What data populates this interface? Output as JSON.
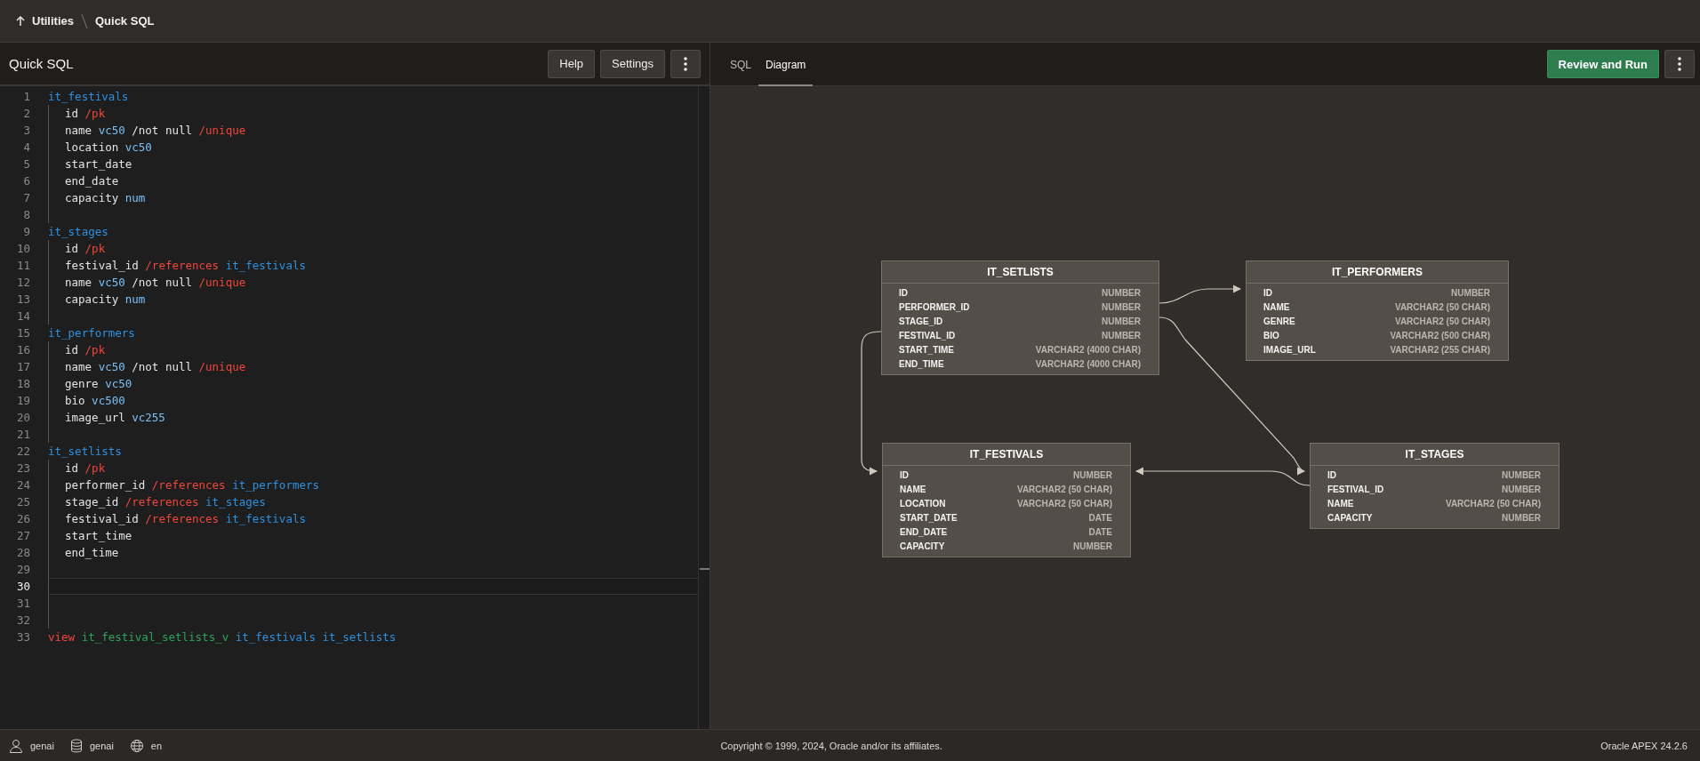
{
  "breadcrumb": [
    {
      "label": "Utilities"
    },
    {
      "label": "Quick SQL"
    }
  ],
  "editor": {
    "title": "Quick SQL",
    "buttons": [
      "Help",
      "Settings"
    ],
    "lines": [
      {
        "number": "1",
        "indented": false,
        "current": false,
        "tokens": [
          {
            "text": "it_festivals",
            "kind": "table"
          }
        ]
      },
      {
        "number": "2",
        "indented": true,
        "current": false,
        "tokens": [
          {
            "text": "id",
            "kind": "plain"
          },
          {
            "text": "/pk",
            "kind": "directive"
          }
        ]
      },
      {
        "number": "3",
        "indented": true,
        "current": false,
        "tokens": [
          {
            "text": "name",
            "kind": "plain"
          },
          {
            "text": "vc50",
            "kind": "datatype"
          },
          {
            "text": "/not null",
            "kind": "plain"
          },
          {
            "text": "/unique",
            "kind": "directive"
          }
        ]
      },
      {
        "number": "4",
        "indented": true,
        "current": false,
        "tokens": [
          {
            "text": "location",
            "kind": "plain"
          },
          {
            "text": "vc50",
            "kind": "datatype"
          }
        ]
      },
      {
        "number": "5",
        "indented": true,
        "current": false,
        "tokens": [
          {
            "text": "start_date",
            "kind": "plain"
          }
        ]
      },
      {
        "number": "6",
        "indented": true,
        "current": false,
        "tokens": [
          {
            "text": "end_date",
            "kind": "plain"
          }
        ]
      },
      {
        "number": "7",
        "indented": true,
        "current": false,
        "tokens": [
          {
            "text": "capacity",
            "kind": "plain"
          },
          {
            "text": "num",
            "kind": "datatype"
          }
        ]
      },
      {
        "number": "8",
        "indented": true,
        "current": false
      },
      {
        "number": "9",
        "indented": false,
        "current": false,
        "tokens": [
          {
            "text": "it_stages",
            "kind": "table"
          }
        ]
      },
      {
        "number": "10",
        "indented": true,
        "current": false,
        "tokens": [
          {
            "text": "id",
            "kind": "plain"
          },
          {
            "text": "/pk",
            "kind": "directive"
          }
        ]
      },
      {
        "number": "11",
        "indented": true,
        "current": false,
        "tokens": [
          {
            "text": "festival_id",
            "kind": "plain"
          },
          {
            "text": "/references",
            "kind": "directive"
          },
          {
            "text": "it_festivals",
            "kind": "table"
          }
        ]
      },
      {
        "number": "12",
        "indented": true,
        "current": false,
        "tokens": [
          {
            "text": "name",
            "kind": "plain"
          },
          {
            "text": "vc50",
            "kind": "datatype"
          },
          {
            "text": "/not null",
            "kind": "plain"
          },
          {
            "text": "/unique",
            "kind": "directive"
          }
        ]
      },
      {
        "number": "13",
        "indented": true,
        "current": false,
        "tokens": [
          {
            "text": "capacity",
            "kind": "plain"
          },
          {
            "text": "num",
            "kind": "datatype"
          }
        ]
      },
      {
        "number": "14",
        "indented": true,
        "current": false
      },
      {
        "number": "15",
        "indented": false,
        "current": false,
        "tokens": [
          {
            "text": "it_performers",
            "kind": "table"
          }
        ]
      },
      {
        "number": "16",
        "indented": true,
        "current": false,
        "tokens": [
          {
            "text": "id",
            "kind": "plain"
          },
          {
            "text": "/pk",
            "kind": "directive"
          }
        ]
      },
      {
        "number": "17",
        "indented": true,
        "current": false,
        "tokens": [
          {
            "text": "name",
            "kind": "plain"
          },
          {
            "text": "vc50",
            "kind": "datatype"
          },
          {
            "text": "/not null",
            "kind": "plain"
          },
          {
            "text": "/unique",
            "kind": "directive"
          }
        ]
      },
      {
        "number": "18",
        "indented": true,
        "current": false,
        "tokens": [
          {
            "text": "genre",
            "kind": "plain"
          },
          {
            "text": "vc50",
            "kind": "datatype"
          }
        ]
      },
      {
        "number": "19",
        "indented": true,
        "current": false,
        "tokens": [
          {
            "text": "bio",
            "kind": "plain"
          },
          {
            "text": "vc500",
            "kind": "datatype"
          }
        ]
      },
      {
        "number": "20",
        "indented": true,
        "current": false,
        "tokens": [
          {
            "text": "image_url",
            "kind": "plain"
          },
          {
            "text": "vc255",
            "kind": "datatype"
          }
        ]
      },
      {
        "number": "21",
        "indented": true,
        "current": false
      },
      {
        "number": "22",
        "indented": false,
        "current": false,
        "tokens": [
          {
            "text": "it_setlists",
            "kind": "table"
          }
        ]
      },
      {
        "number": "23",
        "indented": true,
        "current": false,
        "tokens": [
          {
            "text": "id",
            "kind": "plain"
          },
          {
            "text": "/pk",
            "kind": "directive"
          }
        ]
      },
      {
        "number": "24",
        "indented": true,
        "current": false,
        "tokens": [
          {
            "text": "performer_id",
            "kind": "plain"
          },
          {
            "text": "/references",
            "kind": "directive"
          },
          {
            "text": "it_performers",
            "kind": "table"
          }
        ]
      },
      {
        "number": "25",
        "indented": true,
        "current": false,
        "tokens": [
          {
            "text": "stage_id",
            "kind": "plain"
          },
          {
            "text": "/references",
            "kind": "directive"
          },
          {
            "text": "it_stages",
            "kind": "table"
          }
        ]
      },
      {
        "number": "26",
        "indented": true,
        "current": false,
        "tokens": [
          {
            "text": "festival_id",
            "kind": "plain"
          },
          {
            "text": "/references",
            "kind": "directive"
          },
          {
            "text": "it_festivals",
            "kind": "table"
          }
        ]
      },
      {
        "number": "27",
        "indented": true,
        "current": false,
        "tokens": [
          {
            "text": "start_time",
            "kind": "plain"
          }
        ]
      },
      {
        "number": "28",
        "indented": true,
        "current": false,
        "tokens": [
          {
            "text": "end_time",
            "kind": "plain"
          }
        ]
      },
      {
        "number": "29",
        "indented": true,
        "current": false
      },
      {
        "number": "30",
        "indented": true,
        "current": true
      },
      {
        "number": "31",
        "indented": true,
        "current": false
      },
      {
        "number": "32",
        "indented": true,
        "current": false
      },
      {
        "number": "33",
        "indented": false,
        "current": false,
        "tokens": [
          {
            "text": "view",
            "kind": "directive"
          },
          {
            "text": "it_festival_setlists_v",
            "kind": "view"
          },
          {
            "text": "it_festivals",
            "kind": "table"
          },
          {
            "text": "it_setlists",
            "kind": "table"
          }
        ]
      }
    ]
  },
  "tabs": [
    {
      "label": "SQL",
      "selected": false
    },
    {
      "label": "Diagram",
      "selected": true
    }
  ],
  "primary_button": "Review and Run",
  "diagram": {
    "tables": [
      {
        "name": "IT_SETLISTS",
        "columns": [
          {
            "name": "ID",
            "type": "NUMBER"
          },
          {
            "name": "PERFORMER_ID",
            "type": "NUMBER"
          },
          {
            "name": "STAGE_ID",
            "type": "NUMBER"
          },
          {
            "name": "FESTIVAL_ID",
            "type": "NUMBER"
          },
          {
            "name": "START_TIME",
            "type": "VARCHAR2 (4000 CHAR)"
          },
          {
            "name": "END_TIME",
            "type": "VARCHAR2 (4000 CHAR)"
          }
        ]
      },
      {
        "name": "IT_PERFORMERS",
        "columns": [
          {
            "name": "ID",
            "type": "NUMBER"
          },
          {
            "name": "NAME",
            "type": "VARCHAR2 (50 CHAR)"
          },
          {
            "name": "GENRE",
            "type": "VARCHAR2 (50 CHAR)"
          },
          {
            "name": "BIO",
            "type": "VARCHAR2 (500 CHAR)"
          },
          {
            "name": "IMAGE_URL",
            "type": "VARCHAR2 (255 CHAR)"
          }
        ]
      },
      {
        "name": "IT_FESTIVALS",
        "columns": [
          {
            "name": "ID",
            "type": "NUMBER"
          },
          {
            "name": "NAME",
            "type": "VARCHAR2 (50 CHAR)"
          },
          {
            "name": "LOCATION",
            "type": "VARCHAR2 (50 CHAR)"
          },
          {
            "name": "START_DATE",
            "type": "DATE"
          },
          {
            "name": "END_DATE",
            "type": "DATE"
          },
          {
            "name": "CAPACITY",
            "type": "NUMBER"
          }
        ]
      },
      {
        "name": "IT_STAGES",
        "columns": [
          {
            "name": "ID",
            "type": "NUMBER"
          },
          {
            "name": "FESTIVAL_ID",
            "type": "NUMBER"
          },
          {
            "name": "NAME",
            "type": "VARCHAR2 (50 CHAR)"
          },
          {
            "name": "CAPACITY",
            "type": "NUMBER"
          }
        ]
      }
    ]
  },
  "footer": {
    "user": "genai",
    "schema": "genai",
    "language": "en",
    "copyright": "Copyright © 1999, 2024, Oracle and/or its affiliates.",
    "version": "Oracle APEX 24.2.6"
  }
}
